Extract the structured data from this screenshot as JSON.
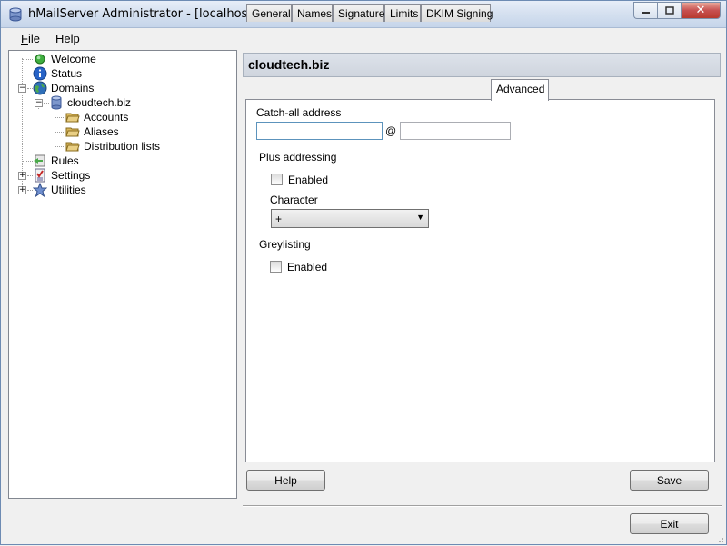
{
  "window": {
    "title": "hMailServer Administrator - [localhost]"
  },
  "menu": {
    "file_prefix": "F",
    "file_rest": "ile",
    "help": "Help"
  },
  "tree": {
    "welcome": "Welcome",
    "status": "Status",
    "domains": "Domains",
    "domain": "cloudtech.biz",
    "accounts": "Accounts",
    "aliases": "Aliases",
    "distribution_lists": "Distribution lists",
    "rules": "Rules",
    "settings": "Settings",
    "utilities": "Utilities"
  },
  "panel": {
    "title": "cloudtech.biz",
    "tabs": [
      "General",
      "Names",
      "Signature",
      "Limits",
      "DKIM Signing",
      "Advanced"
    ]
  },
  "advanced": {
    "catchall_label": "Catch-all address",
    "catchall_user": "",
    "at_sign": "@",
    "catchall_domain": "",
    "plus_heading": "Plus addressing",
    "plus_enabled_label": "Enabled",
    "plus_enabled": false,
    "character_label": "Character",
    "character_value": "+",
    "grey_heading": "Greylisting",
    "grey_enabled_label": "Enabled",
    "grey_enabled": false
  },
  "buttons": {
    "help": "Help",
    "save": "Save",
    "exit": "Exit"
  }
}
